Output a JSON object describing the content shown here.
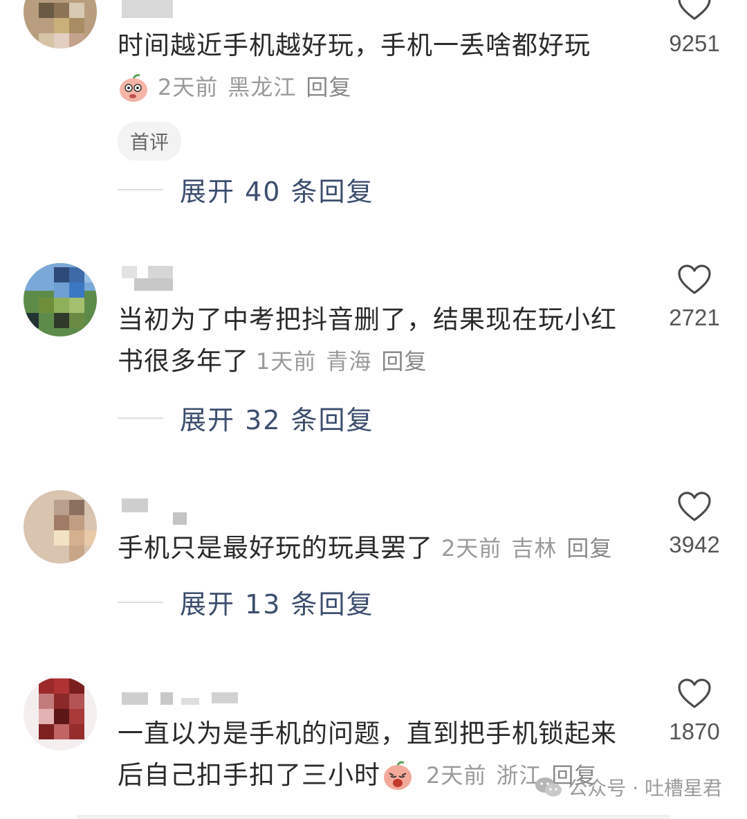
{
  "comments": [
    {
      "text": "时间越近手机越好玩，手机一丢啥都好玩",
      "time": "2天前",
      "location": "黑龙江",
      "reply_label": "回复",
      "likes": "9251",
      "badge": "首评",
      "expand_label": "展开 40 条回复"
    },
    {
      "text_line1": "当初为了中考把抖音删了，结果现在玩小红",
      "text_line2": "书很多年了",
      "time": "1天前",
      "location": "青海",
      "reply_label": "回复",
      "likes": "2721",
      "expand_label": "展开 32 条回复"
    },
    {
      "text": "手机只是最好玩的玩具罢了",
      "time": "2天前",
      "location": "吉林",
      "reply_label": "回复",
      "likes": "3942",
      "expand_label": "展开 13 条回复"
    },
    {
      "text_line1": "一直以为是手机的问题，直到把手机锁起来",
      "text_line2": "后自己扣手扣了三小时",
      "time": "2天前",
      "location": "浙江",
      "reply_label": "回复",
      "likes": "1870"
    }
  ],
  "watermark": "公众号 · 吐槽星君",
  "icons": [
    "heart-icon",
    "wechat-icon",
    "emoji-sticker"
  ]
}
